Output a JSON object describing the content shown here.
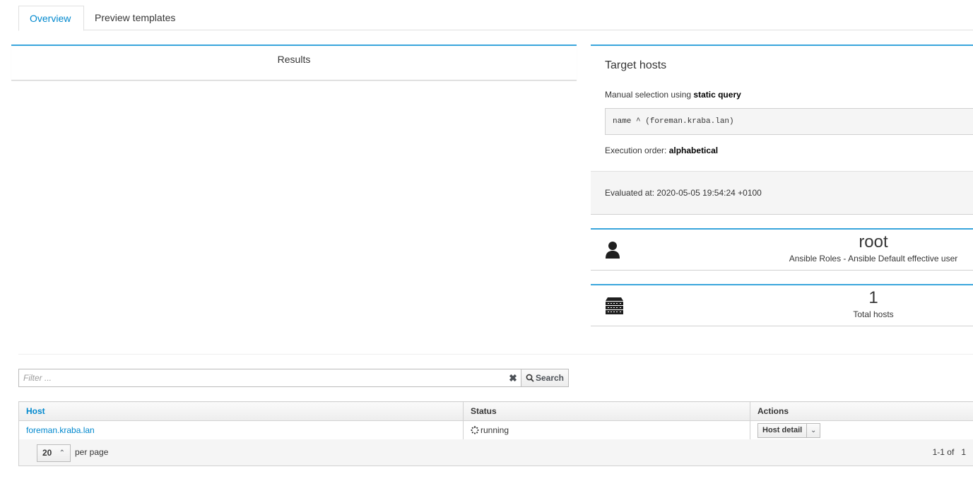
{
  "tabs": {
    "overview": "Overview",
    "preview_templates": "Preview templates"
  },
  "results": {
    "title": "Results"
  },
  "target": {
    "title": "Target hosts",
    "manual_prefix": "Manual selection using ",
    "manual_query_type": "static query",
    "query": "name ^ (foreman.kraba.lan)",
    "order_prefix": "Execution order: ",
    "order_value": "alphabetical",
    "evaluated_at": "Evaluated at: 2020-05-05 19:54:24 +0100"
  },
  "user_card": {
    "icon": "user-icon",
    "value": "root",
    "label": "Ansible Roles - Ansible Default effective user"
  },
  "hosts_card": {
    "icon": "server-stack-icon",
    "value": "1",
    "label": "Total hosts"
  },
  "search": {
    "placeholder": "Filter ...",
    "clear_glyph": "✖",
    "button_label": "Search"
  },
  "table": {
    "columns": [
      "Host",
      "Status",
      "Actions"
    ],
    "rows": [
      {
        "host": "foreman.kraba.lan",
        "status": "running",
        "action": "Host detail"
      }
    ]
  },
  "pagination": {
    "per_page_value": "20",
    "per_page_label": "per page",
    "range": "1-1 of   1"
  },
  "colors": {
    "accent": "#0088ce",
    "card_border": "#39a5dc"
  }
}
